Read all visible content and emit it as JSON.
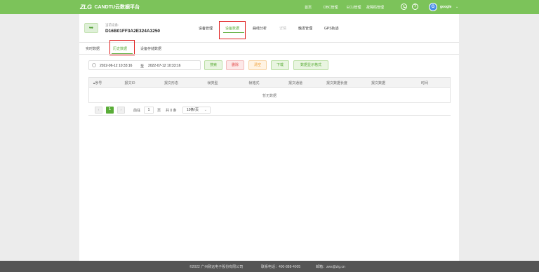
{
  "header": {
    "logo": "ZLG",
    "app_title": "CANDTU云数据平台",
    "nav": [
      "首页",
      "DBC管理",
      "ECU管理",
      "故障码管理"
    ],
    "user": "google",
    "avatar_letter": "G",
    "accent_color": "#7cc35a"
  },
  "device": {
    "back_icon": "back-arrow-icon",
    "label": "当前设备:",
    "id": "D16B01FF3A2E324A3250"
  },
  "device_tabs": [
    "设备管理",
    "设备数据",
    "曲线分析",
    "详情",
    "触发管理",
    "GPS轨迹"
  ],
  "sub_tabs": [
    "实时数据",
    "历史数据",
    "设备存储数据"
  ],
  "filter": {
    "start": "2022-06-12 10:33:16",
    "sep": "至",
    "end": "2022-07-12 10:33:16"
  },
  "buttons": {
    "search": "搜索",
    "delete": "删除",
    "clear": "清空",
    "download": "下载",
    "display_mode": "数据显示格式"
  },
  "table": {
    "columns": [
      "序号",
      "报文ID",
      "报文形态",
      "帧类型",
      "帧格式",
      "报文通道",
      "报文数据长度",
      "报文数据",
      "时间"
    ],
    "empty_text": "暂无数据"
  },
  "pagination": {
    "prev": "‹",
    "current": "1",
    "next": "›",
    "goto_label": "前往",
    "page_input": "1",
    "page_unit": "页",
    "total": "共 0 条",
    "page_size": "10条/页"
  },
  "footer": {
    "copyright": "©2022 广州致远电子股份有限公司",
    "phone": "联系电话：400-888-4005",
    "email": "邮箱：zws@zlg.cn"
  }
}
